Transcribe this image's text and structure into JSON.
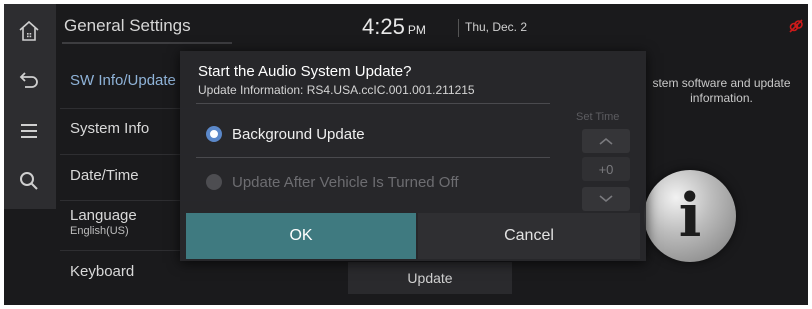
{
  "header": {
    "page_title": "General Settings",
    "time": "4:25",
    "ampm": "PM",
    "date": "Thu, Dec. 2"
  },
  "rail": {
    "icons": [
      "home-icon",
      "back-icon",
      "menu-icon",
      "search-icon"
    ]
  },
  "menu": {
    "items": [
      {
        "label": "SW Info/Update",
        "sub": ""
      },
      {
        "label": "System Info",
        "sub": ""
      },
      {
        "label": "Date/Time",
        "sub": ""
      },
      {
        "label": "Language",
        "sub": "English(US)"
      },
      {
        "label": "Keyboard",
        "sub": ""
      }
    ]
  },
  "right_panel": {
    "description": "stem software and update information.",
    "update_button": "Update"
  },
  "dialog": {
    "title": "Start the Audio System Update?",
    "info": "Update Information: RS4.USA.ccIC.001.001.211215",
    "options": [
      {
        "label": "Background Update",
        "selected": true
      },
      {
        "label": "Update After Vehicle Is Turned Off",
        "selected": false
      }
    ],
    "set_time_label": "Set Time",
    "set_time_value": "+0",
    "ok": "OK",
    "cancel": "Cancel"
  },
  "colors": {
    "accent": "#5b88c9",
    "ok_button": "#3f7a80",
    "active_menu": "#8fb3d8",
    "status_icon": "#cc1a1a"
  }
}
